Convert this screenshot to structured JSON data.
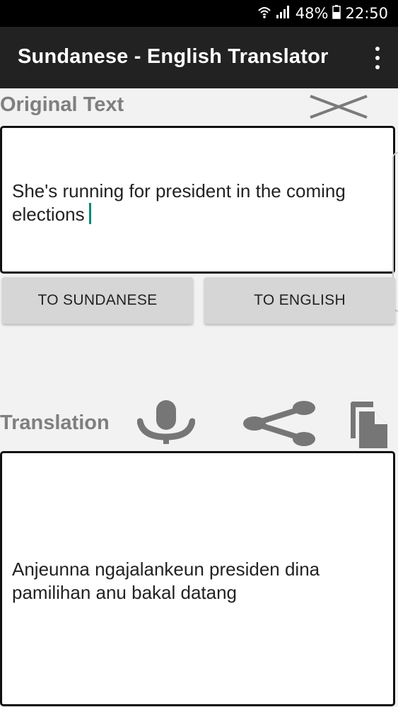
{
  "status_bar": {
    "battery": "48%",
    "time": "22:50",
    "icons": [
      "wifi-icon",
      "signal-icon",
      "battery-icon"
    ]
  },
  "app_bar": {
    "title": "Sundanese - English Translator",
    "menu_icon": "overflow-menu-icon"
  },
  "original": {
    "label": "Original Text",
    "clear_icon": "clear-icon",
    "text": "She's running for president in the coming elections"
  },
  "buttons": {
    "to_sundanese": "TO SUNDANESE",
    "to_english": "TO ENGLISH"
  },
  "translation": {
    "label": "Translation",
    "icons": [
      "microphone-icon",
      "share-icon",
      "copy-icon"
    ],
    "text": "Anjeunna ngajalankeun presiden dina pamilihan anu bakal datang"
  },
  "colors": {
    "app_bar": "#222222",
    "background": "#f2f2f2",
    "label_gray": "#7f7f7f",
    "icon_gray": "#757575",
    "caret": "#00897b",
    "button": "#d6d6d6"
  }
}
